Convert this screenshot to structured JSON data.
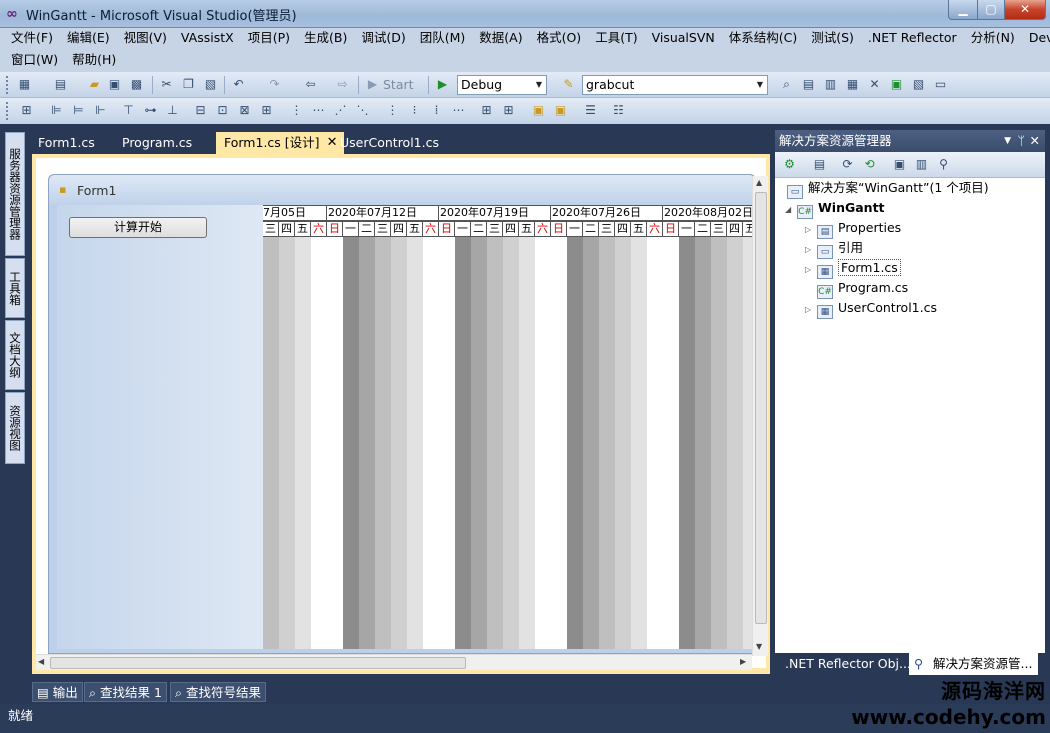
{
  "window": {
    "title": "WinGantt - Microsoft Visual Studio(管理员)",
    "min": "▁",
    "max": "▢",
    "close": "✕"
  },
  "menu": {
    "row1": [
      "文件(F)",
      "编辑(E)",
      "视图(V)",
      "VAssistX",
      "项目(P)",
      "生成(B)",
      "调试(D)",
      "团队(M)",
      "数据(A)",
      "格式(O)",
      "工具(T)",
      "VisualSVN",
      "体系结构(C)",
      "测试(S)",
      ".NET Reflector",
      "分析(N)",
      "DevExpress"
    ],
    "row2": [
      "窗口(W)",
      "帮助(H)"
    ]
  },
  "toolbar": {
    "start_label": "Start",
    "config": "Debug",
    "search": "grabcut"
  },
  "left_dock": [
    "服务器资源管理器",
    "工具箱",
    "文档大纲",
    "资源视图"
  ],
  "doc_tabs": [
    "Form1.cs",
    "Program.cs",
    "Form1.cs [设计]",
    "UserControl1.cs"
  ],
  "form": {
    "title": "Form1",
    "button": "计算开始"
  },
  "gantt": {
    "weeks": [
      "7月05日",
      "2020年07月12日",
      "2020年07月19日",
      "2020年07月26日",
      "2020年08月02日"
    ],
    "days": [
      "三",
      "四",
      "五",
      "六",
      "日",
      "一",
      "二",
      "三",
      "四",
      "五",
      "六",
      "日",
      "一",
      "二",
      "三",
      "四",
      "五",
      "六",
      "日",
      "一",
      "二",
      "三",
      "四",
      "五",
      "六",
      "日",
      "一",
      "二",
      "三",
      "四",
      "五"
    ],
    "weekend_color": "#e00000"
  },
  "solution": {
    "panel_title": "解决方案资源管理器",
    "items": [
      {
        "label": "解决方案“WinGantt”(1 个项目)"
      },
      {
        "label": "WinGantt"
      },
      {
        "label": "Properties"
      },
      {
        "label": "引用"
      },
      {
        "label": "Form1.cs"
      },
      {
        "label": "Program.cs"
      },
      {
        "label": "UserControl1.cs"
      }
    ],
    "bottom_tabs": [
      ".NET Reflector Obj...",
      "解决方案资源管..."
    ]
  },
  "bottom_tabs": [
    "输出",
    "查找结果 1",
    "查找符号结果"
  ],
  "status": "就绪",
  "watermark": {
    "line1": "源码海洋网",
    "line2": "www.codehy.com"
  }
}
